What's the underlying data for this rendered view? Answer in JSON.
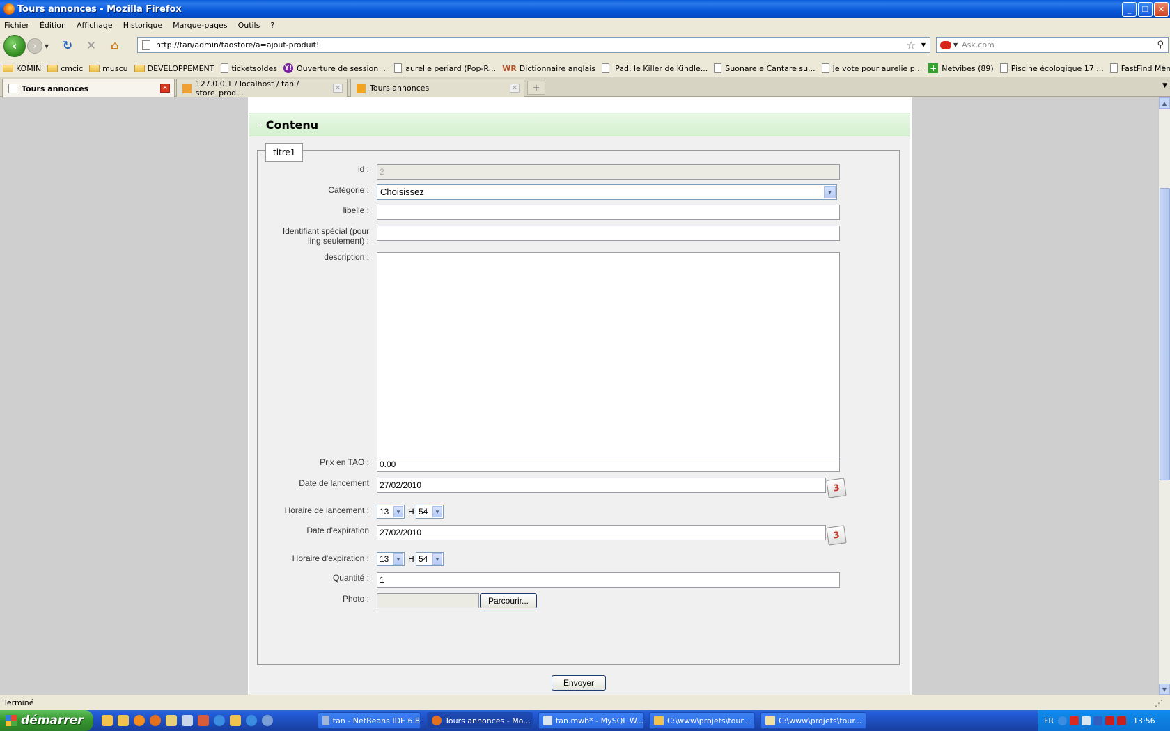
{
  "window": {
    "title": "Tours annonces - Mozilla Firefox"
  },
  "menu": [
    "Fichier",
    "Édition",
    "Affichage",
    "Historique",
    "Marque-pages",
    "Outils",
    "?"
  ],
  "navbar": {
    "url": "http://tan/admin/taostore/a=ajout-produit!",
    "search_placeholder": "Ask.com"
  },
  "bookmarks": [
    {
      "label": "KOMIN",
      "icon": "folder-icon"
    },
    {
      "label": "cmcic",
      "icon": "folder-icon"
    },
    {
      "label": "muscu",
      "icon": "folder-icon"
    },
    {
      "label": "DEVELOPPEMENT",
      "icon": "folder-icon"
    },
    {
      "label": "ticketsoldes",
      "icon": "page-icon"
    },
    {
      "label": "Ouverture de session ...",
      "icon": "yahoo-icon"
    },
    {
      "label": "aurelie periard (Pop-R...",
      "icon": "page-icon"
    },
    {
      "label": "Dictionnaire anglais",
      "icon": "wordreference-icon"
    },
    {
      "label": "iPad, le Killer de Kindle...",
      "icon": "page-icon"
    },
    {
      "label": "Suonare e Cantare su...",
      "icon": "page-icon"
    },
    {
      "label": "Je vote pour aurelie p...",
      "icon": "page-icon"
    },
    {
      "label": "Netvibes (89)",
      "icon": "plus-icon"
    },
    {
      "label": "Piscine écologique 17 ...",
      "icon": "page-icon"
    },
    {
      "label": "FastFind Menu",
      "icon": "page-icon"
    }
  ],
  "tabs": [
    {
      "label": "Tours annonces"
    },
    {
      "label": "127.0.0.1 / localhost / tan / store_prod..."
    },
    {
      "label": "Tours annonces"
    }
  ],
  "panel": {
    "title": "Contenu",
    "legend": "titre1"
  },
  "form": {
    "id_label": "id :",
    "id_value": "2",
    "category_label": "Catégorie :",
    "category_value": "Choisissez",
    "libelle_label": "libelle :",
    "libelle_value": "",
    "special_id_label_1": "Identifiant spécial (pour",
    "special_id_label_2": "ling seulement) :",
    "special_id_value": "",
    "description_label": "description :",
    "price_label": "Prix en TAO :",
    "price_value": "0.00",
    "launch_date_label": "Date de lancement",
    "launch_date_value": "27/02/2010",
    "launch_time_label": "Horaire de lancement :",
    "launch_hour": "13",
    "launch_minute": "54",
    "expiry_date_label": "Date d'expiration",
    "expiry_date_value": "27/02/2010",
    "expiry_time_label": "Horaire d'expiration :",
    "expiry_hour": "13",
    "expiry_minute": "54",
    "hour_sep": "H",
    "calendar_glyph": "3",
    "quantity_label": "Quantité :",
    "quantity_value": "1",
    "photo_label": "Photo :",
    "browse_label": "Parcourir...",
    "submit_label": "Envoyer"
  },
  "status": "Terminé",
  "taskbar": {
    "start_label": "démarrer",
    "tasks": [
      "tan - NetBeans IDE 6.8",
      "Tours annonces - Mo...",
      "tan.mwb* - MySQL W...",
      "C:\\www\\projets\\tour...",
      "C:\\www\\projets\\tour..."
    ],
    "tray_lang": "FR",
    "clock": "13:56"
  }
}
